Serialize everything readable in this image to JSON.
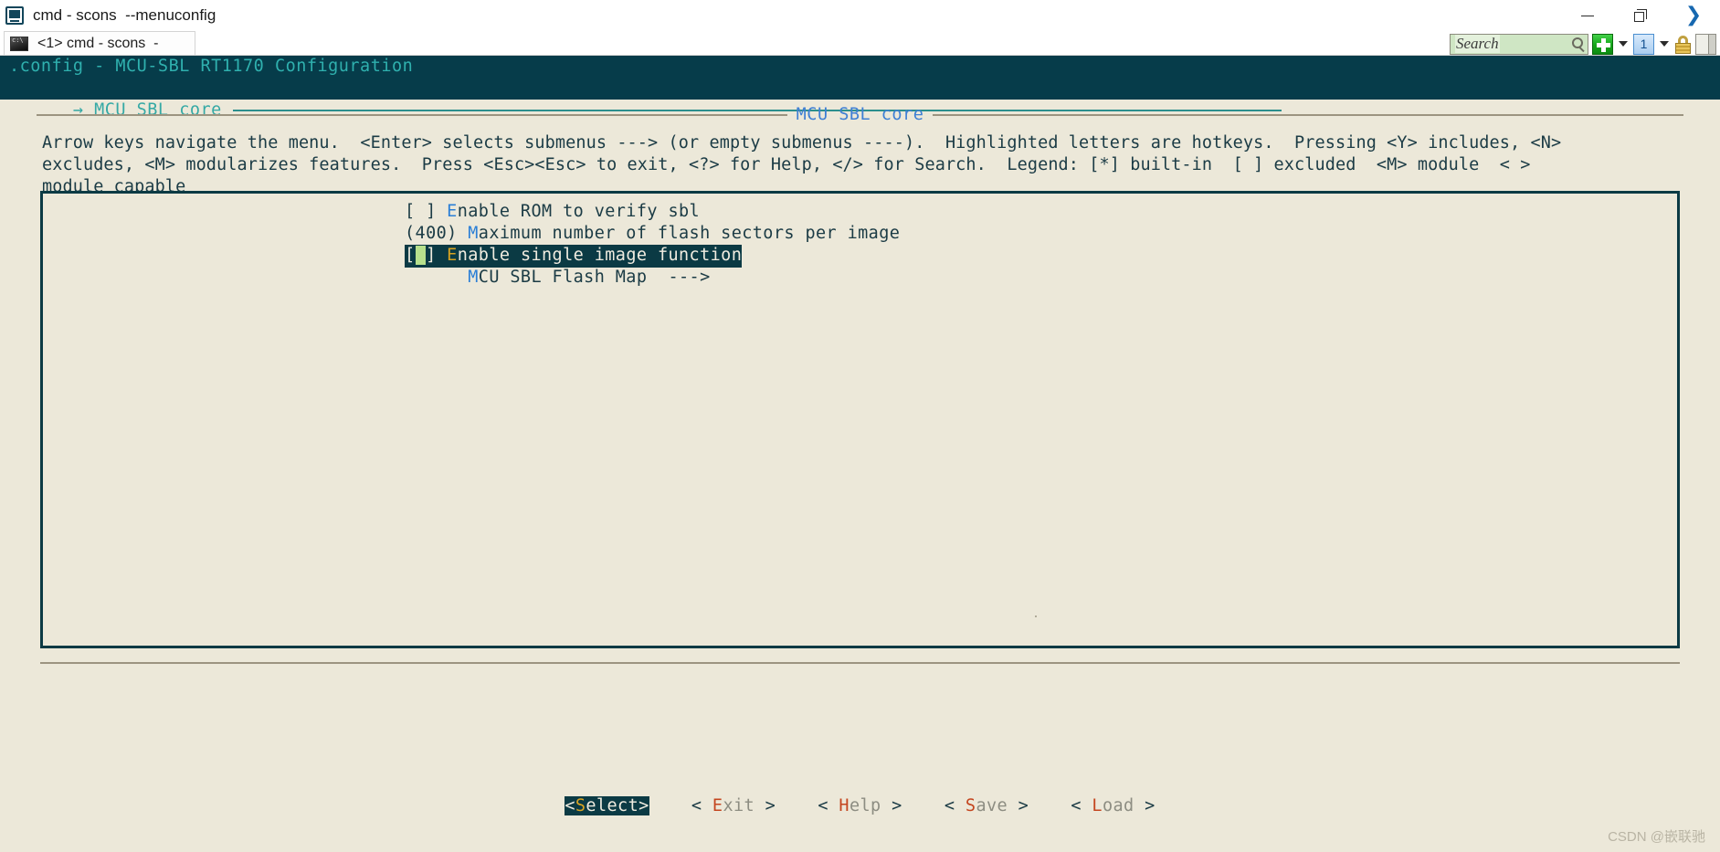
{
  "window": {
    "title": "cmd - scons  --menuconfig",
    "app_icon": "terminal-icon",
    "minimize_label": "—",
    "maximize_label": "❐",
    "close_label": "✕"
  },
  "tabs": [
    {
      "label": "<1> cmd - scons  -",
      "icon": "console-icon"
    }
  ],
  "toolbar": {
    "search_placeholder": "Search",
    "search_value": "",
    "search_icon": "magnifier-icon",
    "new_tab_icon": "green-plus-icon",
    "new_tab_caret": "▼",
    "panes_icon": "blue-one-icon",
    "panes_caret": "▼",
    "lock_icon": "lock-icon",
    "layout_icon": "split-pane-icon"
  },
  "terminal": {
    "config_header": ".config - MCU-SBL RT1170 Configuration",
    "breadcrumb": "→ MCU SBL core",
    "dialog_title": "MCU SBL core",
    "help_text": "Arrow keys navigate the menu.  <Enter> selects submenus ---> (or empty submenus ----).  Highlighted letters are hotkeys.  Pressing <Y> includes, <N>\nexcludes, <M> modularizes features.  Press <Esc><Esc> to exit, <?> for Help, </> for Search.  Legend: [*] built-in  [ ] excluded  <M> module  < >\nmodule capable",
    "menu_items": [
      {
        "prefix": "[ ] ",
        "hotkey": "E",
        "rest": "nable ROM to verify sbl",
        "selected": false
      },
      {
        "prefix": "(400) ",
        "hotkey": "M",
        "rest": "aximum number of flash sectors per image",
        "selected": false
      },
      {
        "prefix_pre": "[",
        "cursor": "*",
        "prefix_post": "] ",
        "hotkey": "E",
        "rest": "nable single image function",
        "selected": true
      },
      {
        "prefix": "      ",
        "hotkey": "M",
        "rest": "CU SBL Flash Map  --->",
        "selected": false
      }
    ],
    "buttons": [
      {
        "open": "<",
        "label_pre": "",
        "hotkey": "S",
        "label_post": "elect",
        "close": ">",
        "active": true
      },
      {
        "open": "<",
        "label_pre": " ",
        "hotkey": "E",
        "label_post": "xit ",
        "close": ">",
        "active": false
      },
      {
        "open": "<",
        "label_pre": " ",
        "hotkey": "H",
        "label_post": "elp ",
        "close": ">",
        "active": false
      },
      {
        "open": "<",
        "label_pre": " ",
        "hotkey": "S",
        "label_post": "ave ",
        "close": ">",
        "active": false
      },
      {
        "open": "<",
        "label_pre": " ",
        "hotkey": "L",
        "label_post": "oad ",
        "close": ">",
        "active": false
      }
    ]
  },
  "watermark": "CSDN @嵌联驰"
}
